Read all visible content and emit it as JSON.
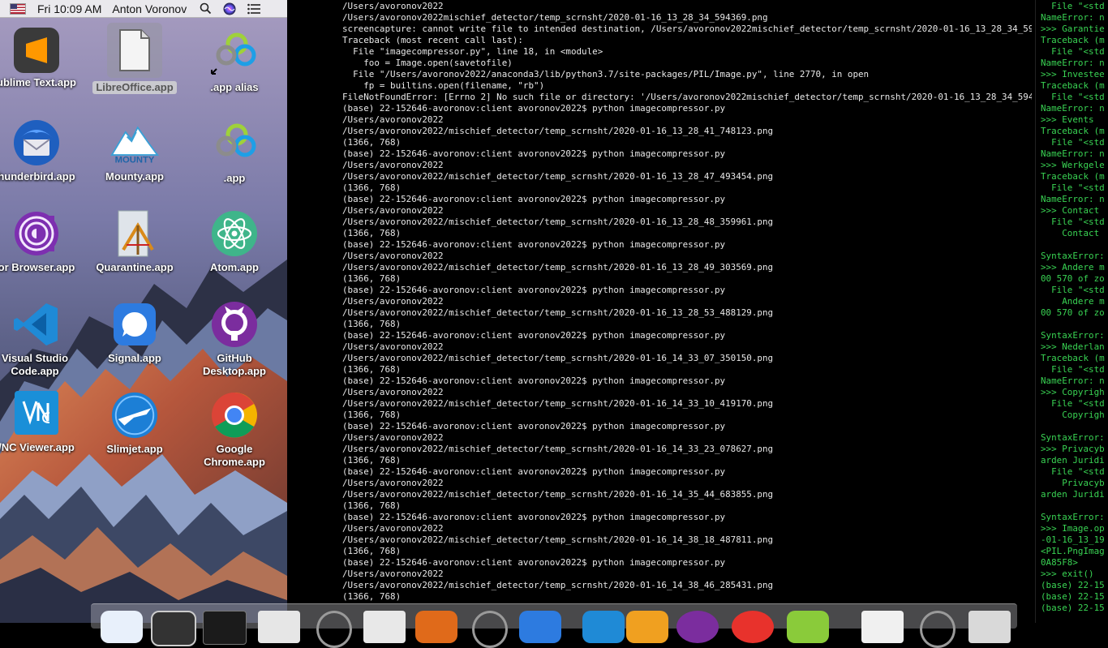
{
  "menubar": {
    "clock": "Fri 10:09 AM",
    "user": "Anton Voronov",
    "icons": [
      "flag-us-icon",
      "search-icon",
      "siri-icon",
      "list-icon"
    ]
  },
  "desktop": {
    "icons": [
      {
        "label": "ublime Text.app"
      },
      {
        "label": "LibreOffice.app"
      },
      {
        "label": ".app alias"
      },
      {
        "label": "hunderbird.app"
      },
      {
        "label": "Mounty.app"
      },
      {
        "label": ".app"
      },
      {
        "label": "or Browser.app"
      },
      {
        "label": "Quarantine.app"
      },
      {
        "label": "Atom.app"
      },
      {
        "label": "Visual Studio Code.app"
      },
      {
        "label": "Signal.app"
      },
      {
        "label": "GitHub Desktop.app"
      },
      {
        "label": "/NC Viewer.app"
      },
      {
        "label": "Slimjet.app"
      },
      {
        "label": "Google Chrome.app"
      }
    ],
    "mounty_text": "MOUNTY"
  },
  "terminal": {
    "lines": [
      "/Users/avoronov2022",
      "/Users/avoronov2022mischief_detector/temp_scrnsht/2020-01-16_13_28_34_594369.png",
      "screencapture: cannot write file to intended destination, /Users/avoronov2022mischief_detector/temp_scrnsht/2020-01-16_13_28_34_594369.png",
      "Traceback (most recent call last):",
      "  File \"imagecompressor.py\", line 18, in <module>",
      "    foo = Image.open(savetofile)",
      "  File \"/Users/avoronov2022/anaconda3/lib/python3.7/site-packages/PIL/Image.py\", line 2770, in open",
      "    fp = builtins.open(filename, \"rb\")",
      "FileNotFoundError: [Errno 2] No such file or directory: '/Users/avoronov2022mischief_detector/temp_scrnsht/2020-01-16_13_28_34_594369.png'",
      "(base) 22-152646-avoronov:client avoronov2022$ python imagecompressor.py",
      "/Users/avoronov2022",
      "/Users/avoronov2022/mischief_detector/temp_scrnsht/2020-01-16_13_28_41_748123.png",
      "(1366, 768)",
      "(base) 22-152646-avoronov:client avoronov2022$ python imagecompressor.py",
      "/Users/avoronov2022",
      "/Users/avoronov2022/mischief_detector/temp_scrnsht/2020-01-16_13_28_47_493454.png",
      "(1366, 768)",
      "(base) 22-152646-avoronov:client avoronov2022$ python imagecompressor.py",
      "/Users/avoronov2022",
      "/Users/avoronov2022/mischief_detector/temp_scrnsht/2020-01-16_13_28_48_359961.png",
      "(1366, 768)",
      "(base) 22-152646-avoronov:client avoronov2022$ python imagecompressor.py",
      "/Users/avoronov2022",
      "/Users/avoronov2022/mischief_detector/temp_scrnsht/2020-01-16_13_28_49_303569.png",
      "(1366, 768)",
      "(base) 22-152646-avoronov:client avoronov2022$ python imagecompressor.py",
      "/Users/avoronov2022",
      "/Users/avoronov2022/mischief_detector/temp_scrnsht/2020-01-16_13_28_53_488129.png",
      "(1366, 768)",
      "(base) 22-152646-avoronov:client avoronov2022$ python imagecompressor.py",
      "/Users/avoronov2022",
      "/Users/avoronov2022/mischief_detector/temp_scrnsht/2020-01-16_14_33_07_350150.png",
      "(1366, 768)",
      "(base) 22-152646-avoronov:client avoronov2022$ python imagecompressor.py",
      "/Users/avoronov2022",
      "/Users/avoronov2022/mischief_detector/temp_scrnsht/2020-01-16_14_33_10_419170.png",
      "(1366, 768)",
      "(base) 22-152646-avoronov:client avoronov2022$ python imagecompressor.py",
      "/Users/avoronov2022",
      "/Users/avoronov2022/mischief_detector/temp_scrnsht/2020-01-16_14_33_23_078627.png",
      "(1366, 768)",
      "(base) 22-152646-avoronov:client avoronov2022$ python imagecompressor.py",
      "/Users/avoronov2022",
      "/Users/avoronov2022/mischief_detector/temp_scrnsht/2020-01-16_14_35_44_683855.png",
      "(1366, 768)",
      "(base) 22-152646-avoronov:client avoronov2022$ python imagecompressor.py",
      "/Users/avoronov2022",
      "/Users/avoronov2022/mischief_detector/temp_scrnsht/2020-01-16_14_38_18_487811.png",
      "(1366, 768)",
      "(base) 22-152646-avoronov:client avoronov2022$ python imagecompressor.py",
      "/Users/avoronov2022",
      "/Users/avoronov2022/mischief_detector/temp_scrnsht/2020-01-16_14_38_46_285431.png",
      "(1366, 768)"
    ]
  },
  "python_terminal": {
    "lines": [
      "  File \"<std",
      "NameError: n",
      ">>> Garantie",
      "Traceback (m",
      "  File \"<std",
      "NameError: n",
      ">>> Investee",
      "Traceback (m",
      "  File \"<std",
      "NameError: n",
      ">>> Events",
      "Traceback (m",
      "  File \"<std",
      "NameError: n",
      ">>> Werkgele",
      "Traceback (m",
      "  File \"<std",
      "NameError: n",
      ">>> Contact",
      "  File \"<std",
      "    Contact",
      "",
      "SyntaxError:",
      ">>> Andere m",
      "00 570 of zo",
      "  File \"<std",
      "    Andere m",
      "00 570 of zo",
      "",
      "SyntaxError:",
      ">>> Nederlan",
      "Traceback (m",
      "  File \"<std",
      "NameError: n",
      ">>> Copyrigh",
      "  File \"<std",
      "    Copyrigh",
      "",
      "SyntaxError:",
      ">>> Privacyb",
      "arden Juridi",
      "  File \"<std",
      "    Privacyb",
      "arden Juridi",
      "",
      "SyntaxError:",
      ">>> Image.op",
      "-01-16_13_19",
      "<PIL.PngImag",
      "0A85F8>",
      ">>> exit()",
      "(base) 22-15",
      "(base) 22-15",
      "(base) 22-15"
    ]
  },
  "colors": {
    "terminal_text": "#e8e8e8",
    "python_text": "#39d353",
    "terminal_bg": "#000000"
  }
}
